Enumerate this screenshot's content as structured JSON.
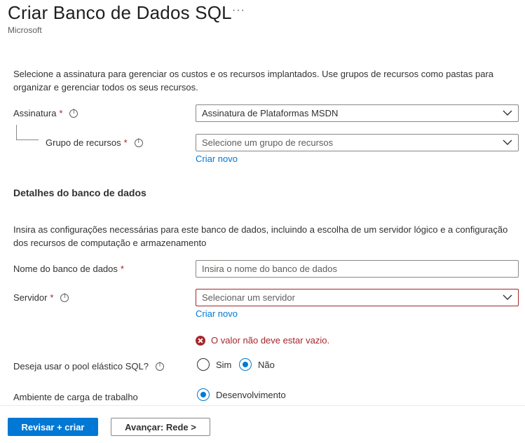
{
  "header": {
    "title": "Criar Banco de Dados SQL",
    "more": "···",
    "publisher": "Microsoft"
  },
  "project": {
    "description": "Selecione a assinatura para gerenciar os custos e os recursos implantados. Use grupos de recursos como pastas para organizar e gerenciar todos os seus recursos.",
    "subscription": {
      "label": "Assinatura",
      "value": "Assinatura de Plataformas MSDN"
    },
    "resource_group": {
      "label": "Grupo de recursos",
      "placeholder": "Selecione um grupo de recursos",
      "create_link": "Criar novo"
    }
  },
  "database": {
    "section_title": "Detalhes do banco de dados",
    "description": "Insira as configurações necessárias para este banco de dados, incluindo a escolha de um servidor lógico e a configuração dos recursos de computação e armazenamento",
    "name": {
      "label": "Nome do banco de dados",
      "placeholder": "Insira o nome do banco de dados"
    },
    "server": {
      "label": "Servidor",
      "placeholder": "Selecionar um servidor",
      "create_link": "Criar novo",
      "error": "O valor não deve estar vazio."
    },
    "elastic_pool": {
      "label": "Deseja usar o pool elástico SQL?",
      "options": [
        "Sim",
        "Não"
      ],
      "selected": "Não"
    },
    "workload": {
      "label": "Ambiente de carga de trabalho",
      "option": "Desenvolvimento"
    }
  },
  "footer": {
    "review_label": "Revisar + criar",
    "next_label": "Avançar: Rede >"
  },
  "colors": {
    "accent": "#0078d4",
    "error": "#a4262c"
  }
}
